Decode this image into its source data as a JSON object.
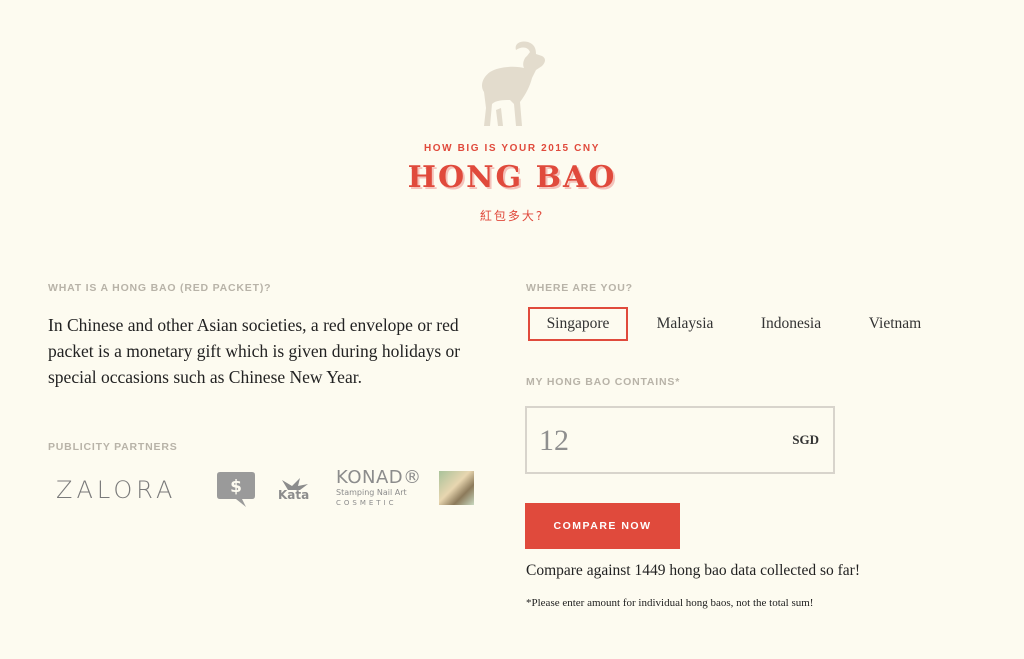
{
  "header": {
    "tagline": "HOW BIG IS YOUR 2015 CNY",
    "title": "HONG BAO",
    "subtitle_cn": "紅包多大?"
  },
  "about": {
    "heading": "WHAT IS A HONG BAO (RED PACKET)?",
    "text": "In Chinese and other Asian societies, a red envelope or red packet is a monetary gift which is given during holidays or special occasions such as Chinese New Year."
  },
  "partners": {
    "heading": "PUBLICITY PARTNERS",
    "zalora": "ZALORA",
    "money_symbol": "$",
    "kata": "Kata",
    "konad_name": "KONAD®",
    "konad_line2": "Stamping Nail Art",
    "konad_line3": "COSMETIC"
  },
  "location": {
    "heading": "WHERE ARE YOU?",
    "countries": [
      "Singapore",
      "Malaysia",
      "Indonesia",
      "Vietnam"
    ],
    "selected": "Singapore"
  },
  "amount": {
    "heading": "MY HONG BAO CONTAINS*",
    "value": "12",
    "currency": "SGD"
  },
  "compare_button": "COMPARE NOW",
  "stats_text": "Compare against 1449 hong bao data collected so far!",
  "note": "*Please enter amount for individual hong baos, not the total sum!",
  "colors": {
    "background": "#fdfbf0",
    "accent_red": "#e04a3c",
    "goat": "#e3dccd",
    "label_gray": "#b8b3a8"
  },
  "icons": [
    "goat-logo-icon",
    "money-bubble-icon",
    "kata-bird-icon"
  ]
}
